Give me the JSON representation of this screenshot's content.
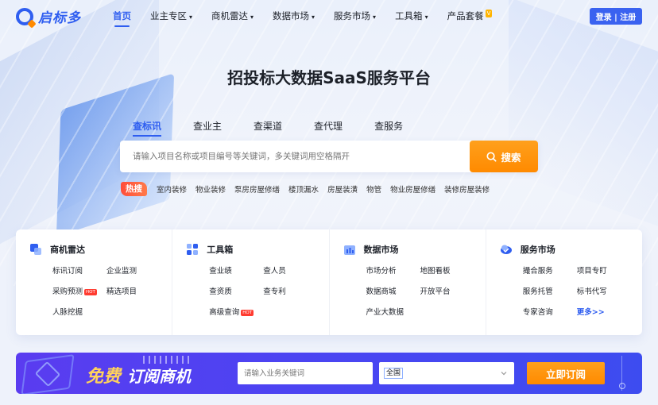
{
  "logo": {
    "text": "启标多"
  },
  "nav": {
    "items": [
      {
        "label": "首页",
        "active": true,
        "dropdown": false
      },
      {
        "label": "业主专区",
        "active": false,
        "dropdown": true
      },
      {
        "label": "商机雷达",
        "active": false,
        "dropdown": true
      },
      {
        "label": "数据市场",
        "active": false,
        "dropdown": true
      },
      {
        "label": "服务市场",
        "active": false,
        "dropdown": true
      },
      {
        "label": "工具箱",
        "active": false,
        "dropdown": true
      },
      {
        "label": "产品套餐",
        "active": false,
        "dropdown": false,
        "badge": "V"
      }
    ],
    "caret": "▾",
    "login_label": "登录 | 注册"
  },
  "hero": {
    "title": "招投标大数据SaaS服务平台",
    "tabs": [
      "查标讯",
      "查业主",
      "查渠道",
      "查代理",
      "查服务"
    ],
    "active_tab": 0,
    "search": {
      "placeholder": "请输入项目名称或项目编号等关键词，多关键词用空格隔开",
      "button_label": "搜索"
    },
    "hot": {
      "badge": "热搜",
      "keywords": [
        "室内装修",
        "物业装修",
        "泵房房屋修缮",
        "楼顶漏水",
        "房屋装潢",
        "物管",
        "物业房屋修缮",
        "装修房屋装修"
      ]
    }
  },
  "features": [
    {
      "title": "商机雷达",
      "icon": "radar-icon",
      "links": [
        {
          "label": "标讯订阅"
        },
        {
          "label": "企业监测"
        },
        {
          "label": "采购预测",
          "tag": "HOT"
        },
        {
          "label": "精选项目"
        },
        {
          "label": "人脉挖掘"
        }
      ]
    },
    {
      "title": "工具箱",
      "icon": "toolbox-icon",
      "links": [
        {
          "label": "查业绩"
        },
        {
          "label": "查人员"
        },
        {
          "label": "查资质"
        },
        {
          "label": "查专利"
        },
        {
          "label": "高级查询",
          "tag": "HOT"
        }
      ]
    },
    {
      "title": "数据市场",
      "icon": "data-market-icon",
      "links": [
        {
          "label": "市场分析"
        },
        {
          "label": "地图看板"
        },
        {
          "label": "数据商城"
        },
        {
          "label": "开放平台"
        },
        {
          "label": "产业大数据"
        }
      ]
    },
    {
      "title": "服务市场",
      "icon": "service-market-icon",
      "links": [
        {
          "label": "撮合服务"
        },
        {
          "label": "项目专盯"
        },
        {
          "label": "服务托管"
        },
        {
          "label": "标书代写"
        },
        {
          "label": "专家咨询"
        },
        {
          "label": "更多>>",
          "more": true
        }
      ]
    }
  ],
  "banner": {
    "free": "免费",
    "subtitle": "订阅商机",
    "input_placeholder": "请输入业务关键词",
    "region_value": "全国",
    "button_label": "立即订阅"
  },
  "colors": {
    "primary": "#2f5ef0",
    "accent": "#ff8a00",
    "hot": "#ff4d3a",
    "banner": "#4a45f2"
  }
}
